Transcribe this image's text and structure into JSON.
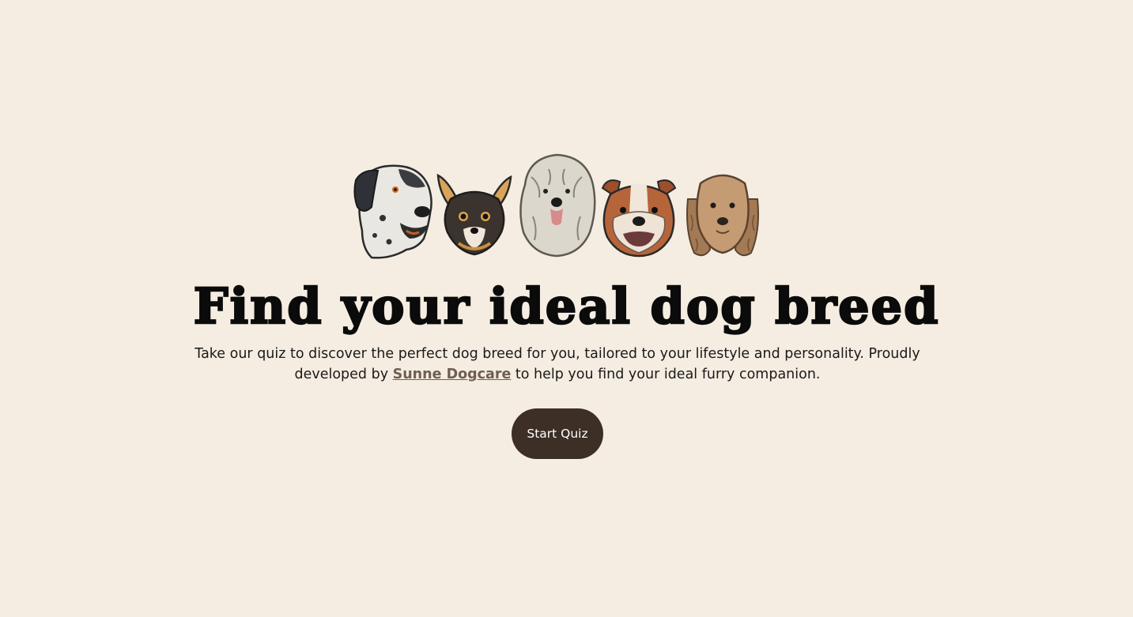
{
  "hero": {
    "title": "Find your ideal dog breed",
    "intro_before": "Take our quiz to discover the perfect dog breed for you, tailored to your lifestyle and personality. Proudly developed by ",
    "intro_link": "Sunne Dogcare",
    "intro_after": " to help you find your ideal furry companion.",
    "start_button": "Start Quiz"
  },
  "dogs": [
    {
      "icon": "great-dane-icon"
    },
    {
      "icon": "chihuahua-icon"
    },
    {
      "icon": "sheepdog-icon"
    },
    {
      "icon": "bulldog-icon"
    },
    {
      "icon": "cocker-spaniel-icon"
    }
  ],
  "colors": {
    "background": "#f5ede1",
    "button": "#3d2e26",
    "link": "#6f5f52",
    "title": "#0b0b0b"
  }
}
